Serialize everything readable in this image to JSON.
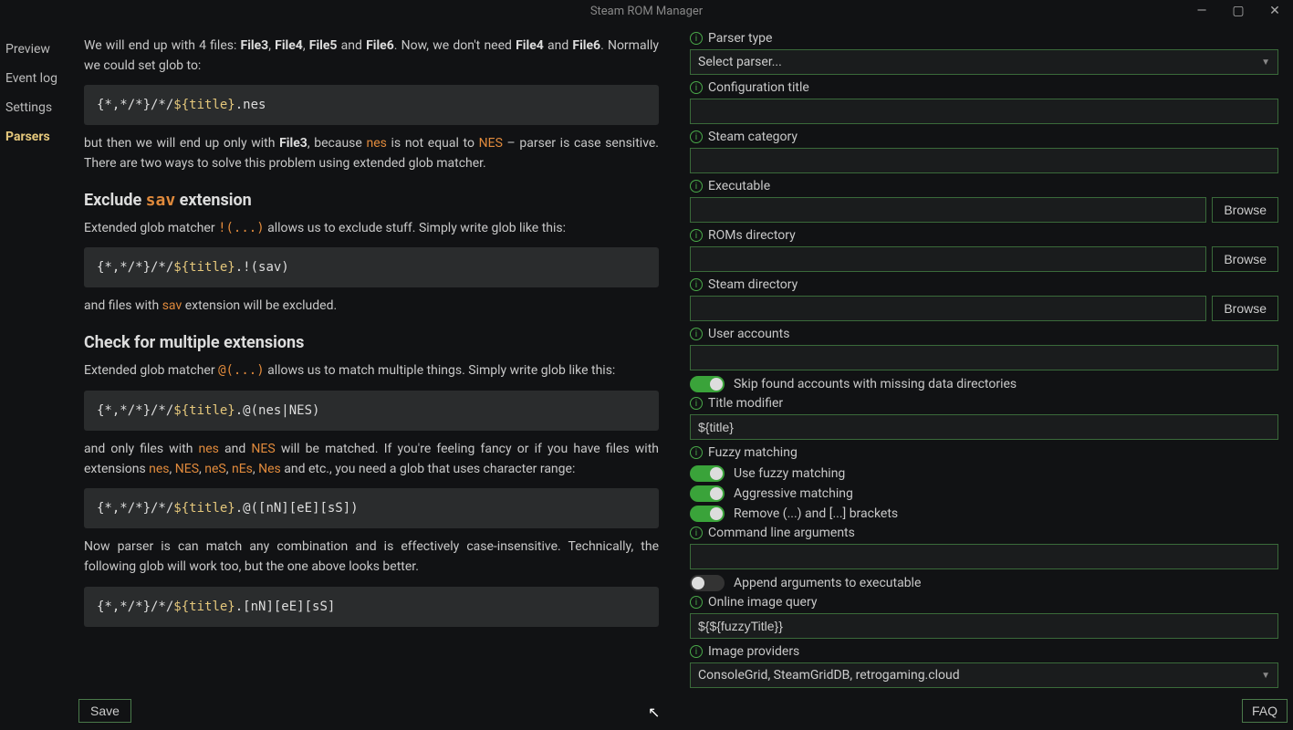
{
  "window": {
    "title": "Steam ROM Manager"
  },
  "sidebar": {
    "items": [
      {
        "label": "Preview",
        "active": false
      },
      {
        "label": "Event log",
        "active": false
      },
      {
        "label": "Settings",
        "active": false
      },
      {
        "label": "Parsers",
        "active": true
      }
    ]
  },
  "doc": {
    "intro_a": "We will end up with 4 files: ",
    "file3": "File3",
    "file4": "File4",
    "file5": "File5",
    "file6": "File6",
    "intro_b": ". Now, we don't need ",
    "intro_c": " and ",
    "intro_d": ". Normally we could set glob to:",
    "code1": "{*,*/*}/*/${title}.nes",
    "p2_a": "but then we will end up only with ",
    "p2_b": ", because ",
    "p2_nes": "nes",
    "p2_c": " is not equal to ",
    "p2_NES": "NES",
    "p2_d": " – parser is case sensitive. There are two ways to solve this problem using extended glob matcher.",
    "h1_a": "Exclude ",
    "h1_sav": "sav",
    "h1_b": " extension",
    "p3_a": "Extended glob matcher ",
    "p3_op": "!(...)",
    "p3_b": " allows us to exclude stuff. Simply write glob like this:",
    "code2": "{*,*/*}/*/${title}.!(sav)",
    "p4_a": "and files with ",
    "p4_sav": "sav",
    "p4_b": " extension will be excluded.",
    "h2": "Check for multiple extensions",
    "p5_a": "Extended glob matcher ",
    "p5_op": "@(...)",
    "p5_b": " allows us to match multiple things. Simply write glob like this:",
    "code3": "{*,*/*}/*/${title}.@(nes|NES)",
    "p6_a": "and only files with ",
    "p6_nes": "nes",
    "p6_b": " and ",
    "p6_NES": "NES",
    "p6_c": " will be matched. If you're feeling fancy or if you have files with extensions ",
    "p6_ext1": "nes",
    "p6_ext2": "NES",
    "p6_ext3": "neS",
    "p6_ext4": "nEs",
    "p6_ext5": "Nes",
    "p6_d": " and etc., you need a glob that uses character range:",
    "code4": "{*,*/*}/*/${title}.@([nN][eE][sS])",
    "p7": "Now parser is can match any combination and is effectively case-insensitive. Technically, the following glob will work too, but the one above looks better.",
    "code5": "{*,*/*}/*/${title}.[nN][eE][sS]"
  },
  "form": {
    "parser_type_label": "Parser type",
    "parser_type_value": "Select parser...",
    "config_title_label": "Configuration title",
    "config_title_value": "",
    "steam_cat_label": "Steam category",
    "steam_cat_value": "",
    "executable_label": "Executable",
    "executable_value": "",
    "roms_dir_label": "ROMs directory",
    "roms_dir_value": "",
    "steam_dir_label": "Steam directory",
    "steam_dir_value": "",
    "user_accounts_label": "User accounts",
    "user_accounts_value": "",
    "skip_accounts_label": "Skip found accounts with missing data directories",
    "title_modifier_label": "Title modifier",
    "title_modifier_value": "${title}",
    "fuzzy_label": "Fuzzy matching",
    "use_fuzzy_label": "Use fuzzy matching",
    "aggressive_label": "Aggressive matching",
    "remove_brackets_label": "Remove (...) and [...] brackets",
    "cmdargs_label": "Command line arguments",
    "cmdargs_value": "",
    "append_args_label": "Append arguments to executable",
    "online_image_label": "Online image query",
    "online_image_value": "${${fuzzyTitle}}",
    "image_providers_label": "Image providers",
    "image_providers_value": "ConsoleGrid, SteamGridDB, retrogaming.cloud",
    "browse": "Browse"
  },
  "buttons": {
    "save": "Save",
    "faq": "FAQ"
  }
}
